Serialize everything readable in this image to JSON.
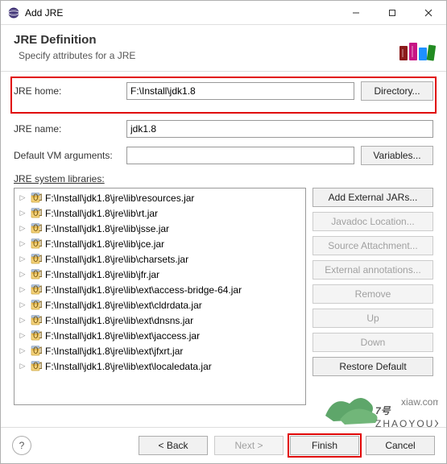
{
  "titlebar": {
    "title": "Add JRE"
  },
  "header": {
    "title": "JRE Definition",
    "subtitle": "Specify attributes for a JRE"
  },
  "form": {
    "jre_home": {
      "label": "JRE home:",
      "value": "F:\\Install\\jdk1.8",
      "button": "Directory..."
    },
    "jre_name": {
      "label": "JRE name:",
      "value": "jdk1.8"
    },
    "vm_args": {
      "label": "Default VM arguments:",
      "value": "",
      "button": "Variables..."
    },
    "libs_label": "JRE system libraries:"
  },
  "libs": [
    "F:\\Install\\jdk1.8\\jre\\lib\\resources.jar",
    "F:\\Install\\jdk1.8\\jre\\lib\\rt.jar",
    "F:\\Install\\jdk1.8\\jre\\lib\\jsse.jar",
    "F:\\Install\\jdk1.8\\jre\\lib\\jce.jar",
    "F:\\Install\\jdk1.8\\jre\\lib\\charsets.jar",
    "F:\\Install\\jdk1.8\\jre\\lib\\jfr.jar",
    "F:\\Install\\jdk1.8\\jre\\lib\\ext\\access-bridge-64.jar",
    "F:\\Install\\jdk1.8\\jre\\lib\\ext\\cldrdata.jar",
    "F:\\Install\\jdk1.8\\jre\\lib\\ext\\dnsns.jar",
    "F:\\Install\\jdk1.8\\jre\\lib\\ext\\jaccess.jar",
    "F:\\Install\\jdk1.8\\jre\\lib\\ext\\jfxrt.jar",
    "F:\\Install\\jdk1.8\\jre\\lib\\ext\\localedata.jar"
  ],
  "side_buttons": {
    "add_ext": "Add External JARs...",
    "javadoc": "Javadoc Location...",
    "source": "Source Attachment...",
    "annot": "External annotations...",
    "remove": "Remove",
    "up": "Up",
    "down": "Down",
    "restore": "Restore Default"
  },
  "footer": {
    "back": "< Back",
    "next": "Next >",
    "finish": "Finish",
    "cancel": "Cancel"
  }
}
